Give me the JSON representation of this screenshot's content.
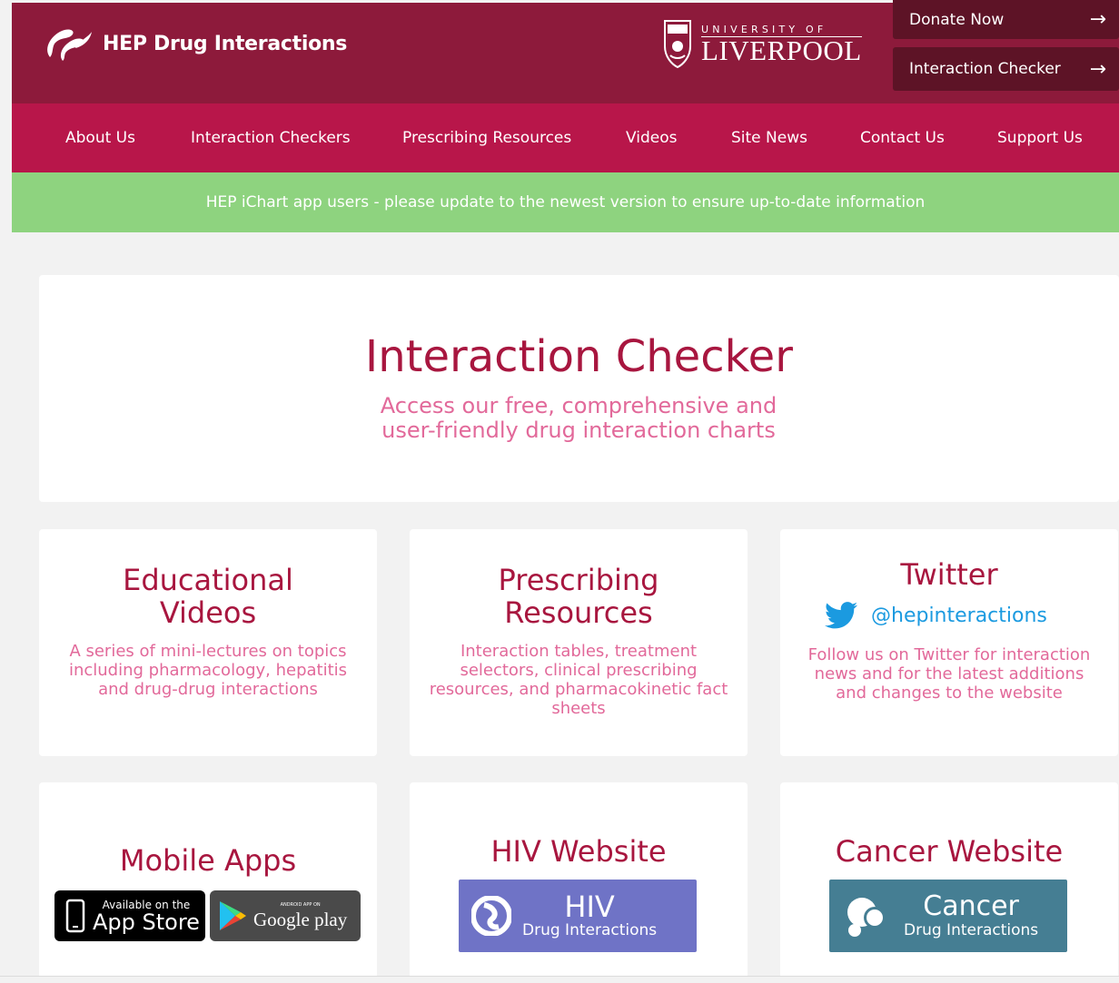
{
  "header": {
    "site_name": "HEP Drug Interactions",
    "university_top": "UNIVERSITY OF",
    "university_bottom": "LIVERPOOL",
    "donate_label": "Donate Now",
    "checker_label": "Interaction Checker",
    "arrow": "→"
  },
  "nav": {
    "items": [
      {
        "label": "About Us"
      },
      {
        "label": "Interaction Checkers"
      },
      {
        "label": "Prescribing Resources"
      },
      {
        "label": "Videos"
      },
      {
        "label": "Site News"
      },
      {
        "label": "Contact Us"
      },
      {
        "label": "Support Us"
      }
    ]
  },
  "banner": {
    "text": "HEP iChart app users - please update to the newest version to ensure up-to-date information"
  },
  "hero": {
    "title": "Interaction Checker",
    "subtitle": "Access our free, comprehensive and user-friendly drug interaction charts"
  },
  "cards": {
    "videos": {
      "title": "Educational Videos",
      "desc": "A series of mini-lectures on topics including pharmacology, hepatitis and drug-drug interactions"
    },
    "resources": {
      "title": "Prescribing Resources",
      "desc": "Interaction tables, treatment selectors, clinical prescribing resources, and pharmacokinetic fact sheets"
    },
    "twitter": {
      "title": "Twitter",
      "handle": "@hepinteractions",
      "desc": "Follow us on Twitter for interaction news and for the latest additions and changes to the website"
    },
    "apps": {
      "title": "Mobile Apps",
      "appstore_small": "Available on the",
      "appstore_big": "App Store",
      "gplay_small": "ANDROID APP ON",
      "gplay_big": "Google play"
    },
    "hiv": {
      "title": "HIV Website",
      "logo_main": "HIV",
      "logo_sub": "Drug Interactions"
    },
    "cancer": {
      "title": "Cancer Website",
      "logo_main": "Cancer",
      "logo_sub": "Drug Interactions"
    }
  },
  "colors": {
    "header_bg": "#8d1a3b",
    "nav_bg": "#b8164a",
    "banner_bg": "#8ed37f",
    "title": "#a8163f",
    "desc": "#e2699a",
    "twitter": "#1b9ae0",
    "hiv": "#6f73c6",
    "cancer": "#457e93"
  },
  "icons": {
    "logo": "hep-logo-icon",
    "crest": "university-crest-icon",
    "twitter": "twitter-bird-icon",
    "apple": "apple-phone-icon",
    "google_play": "google-play-icon",
    "hiv": "hiv-logo-icon",
    "cancer": "cancer-logo-icon"
  }
}
